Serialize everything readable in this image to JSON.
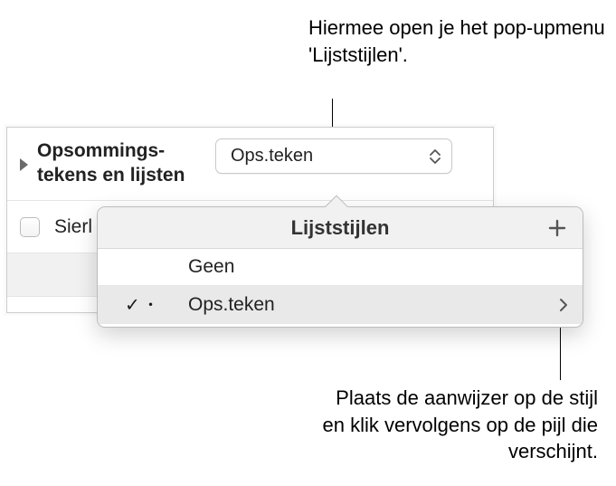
{
  "annotations": {
    "top": "Hiermee open je het pop-upmenu 'Lijststijlen'.",
    "bottom": "Plaats de aanwijzer op de stijl en klik vervolgens op de pijl die verschijnt."
  },
  "panel": {
    "section_label": "Opsommings-tekens en lijsten",
    "popup_value": "Ops.teken",
    "row2_label": "Sierl"
  },
  "popover": {
    "title": "Lijststijlen",
    "items": [
      {
        "label": "Geen",
        "selected": false,
        "has_arrow": false
      },
      {
        "label": "Ops.teken",
        "selected": true,
        "has_arrow": true
      }
    ]
  }
}
